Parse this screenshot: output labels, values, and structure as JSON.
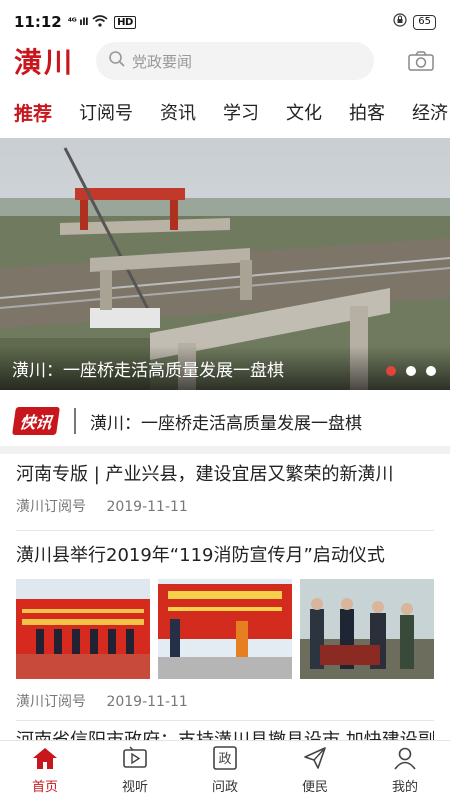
{
  "status_bar": {
    "time": "11:12",
    "signal": "⁴ᴳ ıll",
    "hd": "HD",
    "battery": "65"
  },
  "header": {
    "logo": "潢川",
    "search_placeholder": "党政要闻"
  },
  "tabs": [
    {
      "label": "推荐",
      "active": true
    },
    {
      "label": "订阅号"
    },
    {
      "label": "资讯"
    },
    {
      "label": "学习"
    },
    {
      "label": "文化"
    },
    {
      "label": "拍客"
    },
    {
      "label": "经济"
    }
  ],
  "banner": {
    "caption": "潢川：一座桥走活高质量发展一盘棋",
    "slide_count": 3,
    "active_slide": 1
  },
  "flash": {
    "badge": "快讯",
    "text": "潢川：一座桥走活高质量发展一盘棋"
  },
  "articles": [
    {
      "title": "河南专版 | 产业兴县，建设宜居又繁荣的新潢川",
      "source": "潢川订阅号",
      "date": "2019-11-11"
    },
    {
      "title": "潢川县举行2019年“119消防宣传月”启动仪式",
      "source": "潢川订阅号",
      "date": "2019-11-11"
    },
    {
      "title": "河南省信阳市政府：支持潢川县撤县设市 加快建设副"
    }
  ],
  "bottom_nav": [
    {
      "label": "首页",
      "icon": "home-icon",
      "active": true
    },
    {
      "label": "视听",
      "icon": "tv-icon"
    },
    {
      "label": "问政",
      "icon": "zheng-icon"
    },
    {
      "label": "便民",
      "icon": "send-icon"
    },
    {
      "label": "我的",
      "icon": "user-icon"
    }
  ],
  "colors": {
    "brand": "#c8161d",
    "dot_active": "#e0443a"
  }
}
